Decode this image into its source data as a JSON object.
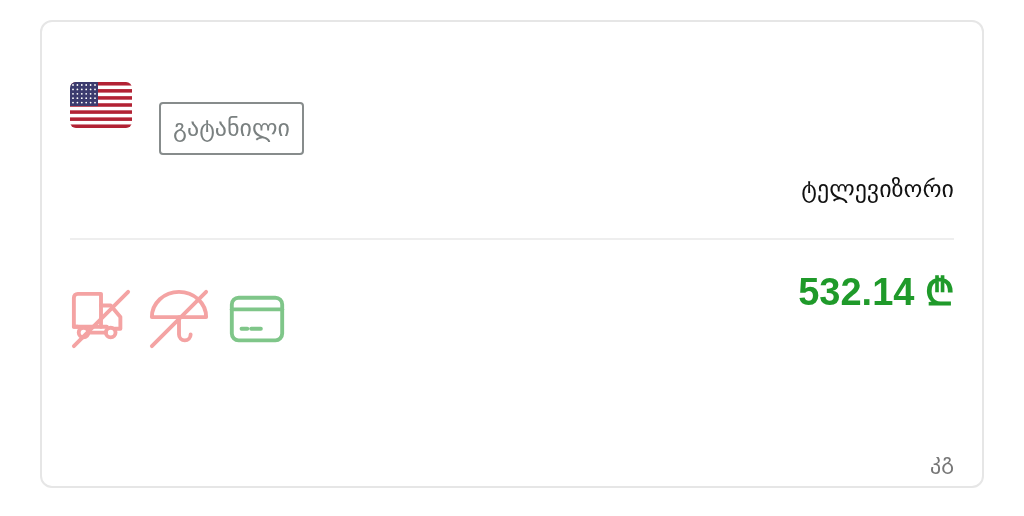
{
  "product": {
    "badge": "გატანილი",
    "title": "ტელევიზორი",
    "price": "532.14 ₾",
    "unit": "კგ"
  },
  "features": [
    {
      "kind": "delivery",
      "available": false
    },
    {
      "kind": "umbrella",
      "available": false
    },
    {
      "kind": "card",
      "available": true
    }
  ]
}
